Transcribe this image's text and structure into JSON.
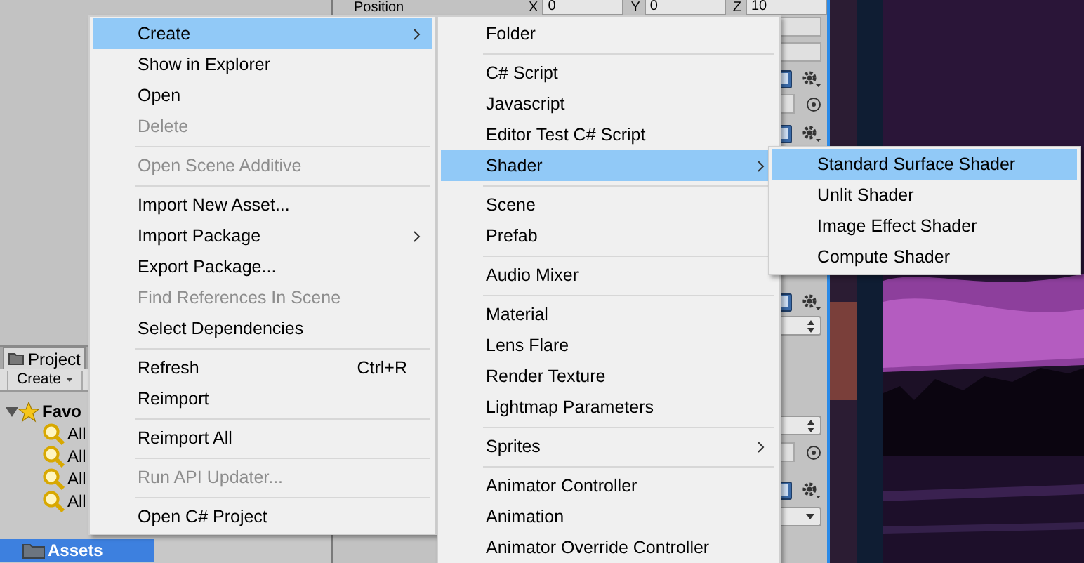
{
  "inspector": {
    "position_label": "Position",
    "axes": [
      {
        "axis": "X",
        "value": "0"
      },
      {
        "axis": "Y",
        "value": "0"
      },
      {
        "axis": "Z",
        "value": "10"
      }
    ]
  },
  "project_panel": {
    "tab": "Project",
    "create_button": "Create",
    "tree": [
      {
        "label": "Favo",
        "expanded": true,
        "selected": false,
        "children": [
          {
            "label": "All",
            "selected": false
          },
          {
            "label": "All",
            "selected": false
          },
          {
            "label": "All",
            "selected": false
          },
          {
            "label": "All",
            "selected": false
          }
        ]
      },
      {
        "label": "Assets",
        "selected": true
      }
    ]
  },
  "context_menu": {
    "items": [
      {
        "kind": "item",
        "label": "Create",
        "selected": true,
        "disabled": false,
        "submenu": true
      },
      {
        "kind": "item",
        "label": "Show in Explorer",
        "selected": false,
        "disabled": false,
        "submenu": false
      },
      {
        "kind": "item",
        "label": "Open",
        "selected": false,
        "disabled": false,
        "submenu": false
      },
      {
        "kind": "item",
        "label": "Delete",
        "selected": false,
        "disabled": true,
        "submenu": false
      },
      {
        "kind": "separator"
      },
      {
        "kind": "item",
        "label": "Open Scene Additive",
        "selected": false,
        "disabled": true,
        "submenu": false
      },
      {
        "kind": "separator"
      },
      {
        "kind": "item",
        "label": "Import New Asset...",
        "selected": false,
        "disabled": false,
        "submenu": false
      },
      {
        "kind": "item",
        "label": "Import Package",
        "selected": false,
        "disabled": false,
        "submenu": true
      },
      {
        "kind": "item",
        "label": "Export Package...",
        "selected": false,
        "disabled": false,
        "submenu": false
      },
      {
        "kind": "item",
        "label": "Find References In Scene",
        "selected": false,
        "disabled": true,
        "submenu": false
      },
      {
        "kind": "item",
        "label": "Select Dependencies",
        "selected": false,
        "disabled": false,
        "submenu": false
      },
      {
        "kind": "separator"
      },
      {
        "kind": "item",
        "label": "Refresh",
        "shortcut": "Ctrl+R",
        "selected": false,
        "disabled": false,
        "submenu": false
      },
      {
        "kind": "item",
        "label": "Reimport",
        "selected": false,
        "disabled": false,
        "submenu": false
      },
      {
        "kind": "separator"
      },
      {
        "kind": "item",
        "label": "Reimport All",
        "selected": false,
        "disabled": false,
        "submenu": false
      },
      {
        "kind": "separator"
      },
      {
        "kind": "item",
        "label": "Run API Updater...",
        "selected": false,
        "disabled": true,
        "submenu": false
      },
      {
        "kind": "separator"
      },
      {
        "kind": "item",
        "label": "Open C# Project",
        "selected": false,
        "disabled": false,
        "submenu": false
      }
    ]
  },
  "create_submenu": {
    "items": [
      {
        "kind": "item",
        "label": "Folder",
        "selected": false,
        "submenu": false
      },
      {
        "kind": "separator"
      },
      {
        "kind": "item",
        "label": "C# Script",
        "selected": false,
        "submenu": false
      },
      {
        "kind": "item",
        "label": "Javascript",
        "selected": false,
        "submenu": false
      },
      {
        "kind": "item",
        "label": "Editor Test C# Script",
        "selected": false,
        "submenu": false
      },
      {
        "kind": "item",
        "label": "Shader",
        "selected": true,
        "submenu": true
      },
      {
        "kind": "separator"
      },
      {
        "kind": "item",
        "label": "Scene",
        "selected": false,
        "submenu": false
      },
      {
        "kind": "item",
        "label": "Prefab",
        "selected": false,
        "submenu": false
      },
      {
        "kind": "separator"
      },
      {
        "kind": "item",
        "label": "Audio Mixer",
        "selected": false,
        "submenu": false
      },
      {
        "kind": "separator"
      },
      {
        "kind": "item",
        "label": "Material",
        "selected": false,
        "submenu": false
      },
      {
        "kind": "item",
        "label": "Lens Flare",
        "selected": false,
        "submenu": false
      },
      {
        "kind": "item",
        "label": "Render Texture",
        "selected": false,
        "submenu": false
      },
      {
        "kind": "item",
        "label": "Lightmap Parameters",
        "selected": false,
        "submenu": false
      },
      {
        "kind": "separator"
      },
      {
        "kind": "item",
        "label": "Sprites",
        "selected": false,
        "submenu": true
      },
      {
        "kind": "separator"
      },
      {
        "kind": "item",
        "label": "Animator Controller",
        "selected": false,
        "submenu": false
      },
      {
        "kind": "item",
        "label": "Animation",
        "selected": false,
        "submenu": false
      },
      {
        "kind": "item",
        "label": "Animator Override Controller",
        "selected": false,
        "submenu": false
      }
    ]
  },
  "shader_submenu": {
    "items": [
      {
        "kind": "item",
        "label": "Standard Surface Shader",
        "selected": true,
        "submenu": false
      },
      {
        "kind": "item",
        "label": "Unlit Shader",
        "selected": false,
        "submenu": false
      },
      {
        "kind": "item",
        "label": "Image Effect Shader",
        "selected": false,
        "submenu": false
      },
      {
        "kind": "item",
        "label": "Compute Shader",
        "selected": false,
        "submenu": false
      }
    ]
  }
}
